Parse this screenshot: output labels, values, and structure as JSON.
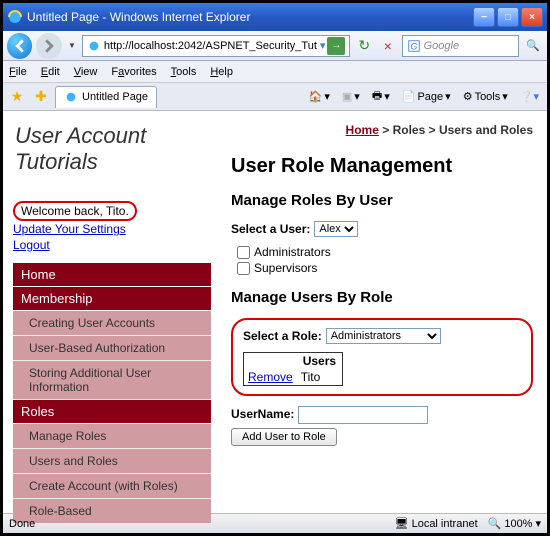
{
  "window": {
    "title": "Untitled Page - Windows Internet Explorer",
    "minimize": "−",
    "maximize": "□",
    "close": "×"
  },
  "address": {
    "url": "http://localhost:2042/ASPNET_Security_Tut",
    "search_placeholder": "Google",
    "refresh": "↻",
    "stop": "×"
  },
  "menu": {
    "file": "File",
    "edit": "Edit",
    "view": "View",
    "favorites": "Favorites",
    "tools": "Tools",
    "help": "Help"
  },
  "tab": {
    "label": "Untitled Page"
  },
  "toolbar": {
    "home": "▾",
    "feeds": "▾",
    "print": "▾",
    "page": "Page",
    "tools": "Tools"
  },
  "page": {
    "site_title": "User Account Tutorials",
    "breadcrumb": {
      "home": "Home",
      "sep1": " > ",
      "l1": "Roles",
      "sep2": " > ",
      "l2": "Users and Roles"
    },
    "welcome": "Welcome back, Tito.",
    "links": {
      "update": "Update Your Settings",
      "logout": "Logout"
    },
    "nav": [
      {
        "type": "top",
        "label": "Home"
      },
      {
        "type": "top",
        "label": "Membership"
      },
      {
        "type": "sub",
        "label": "Creating User Accounts"
      },
      {
        "type": "sub",
        "label": "User-Based Authorization"
      },
      {
        "type": "sub",
        "label": "Storing Additional User Information"
      },
      {
        "type": "top",
        "label": "Roles"
      },
      {
        "type": "sub",
        "label": "Manage Roles"
      },
      {
        "type": "sub",
        "label": "Users and Roles"
      },
      {
        "type": "sub",
        "label": "Create Account (with Roles)"
      },
      {
        "type": "sub",
        "label": "Role-Based"
      }
    ],
    "main": {
      "h2": "User Role Management",
      "section1": {
        "title": "Manage Roles By User",
        "select_label": "Select a User:",
        "selected": "Alex",
        "checks": [
          {
            "label": "Administrators",
            "checked": false
          },
          {
            "label": "Supervisors",
            "checked": false
          }
        ]
      },
      "section2": {
        "title": "Manage Users By Role",
        "select_label": "Select a Role:",
        "selected": "Administrators",
        "table": {
          "header": "Users",
          "rows": [
            {
              "action": "Remove",
              "user": "Tito"
            }
          ]
        }
      },
      "username_label": "UserName:",
      "username_value": "",
      "add_button": "Add User to Role"
    }
  },
  "status": {
    "done": "Done",
    "zone": "Local intranet",
    "zoom": "100%"
  }
}
